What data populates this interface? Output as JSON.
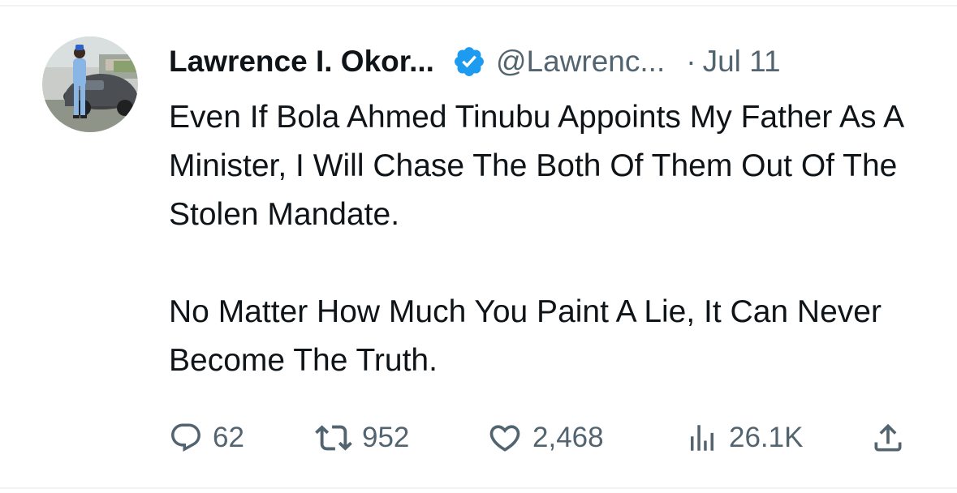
{
  "tweet": {
    "author_name": "Lawrence I. Okor...",
    "handle": "@Lawrenc...",
    "separator": "·",
    "date": "Jul 11",
    "verified": true,
    "paragraphs": [
      "Even If Bola Ahmed Tinubu Appoints My Father As A Minister, I Will Chase The Both Of Them Out Of The Stolen Mandate.",
      "No Matter How Much You Paint A Lie, It Can Never Become The Truth."
    ],
    "stats": {
      "replies": "62",
      "retweets": "952",
      "likes": "2,468",
      "views": "26.1K"
    }
  },
  "colors": {
    "text": "#0f1419",
    "secondary": "#536471",
    "verified_blue": "#1d9bf0",
    "divider": "#eff3f4"
  },
  "icons": [
    "reply-icon",
    "retweet-icon",
    "like-icon",
    "views-icon",
    "share-icon",
    "verified-badge-icon"
  ]
}
